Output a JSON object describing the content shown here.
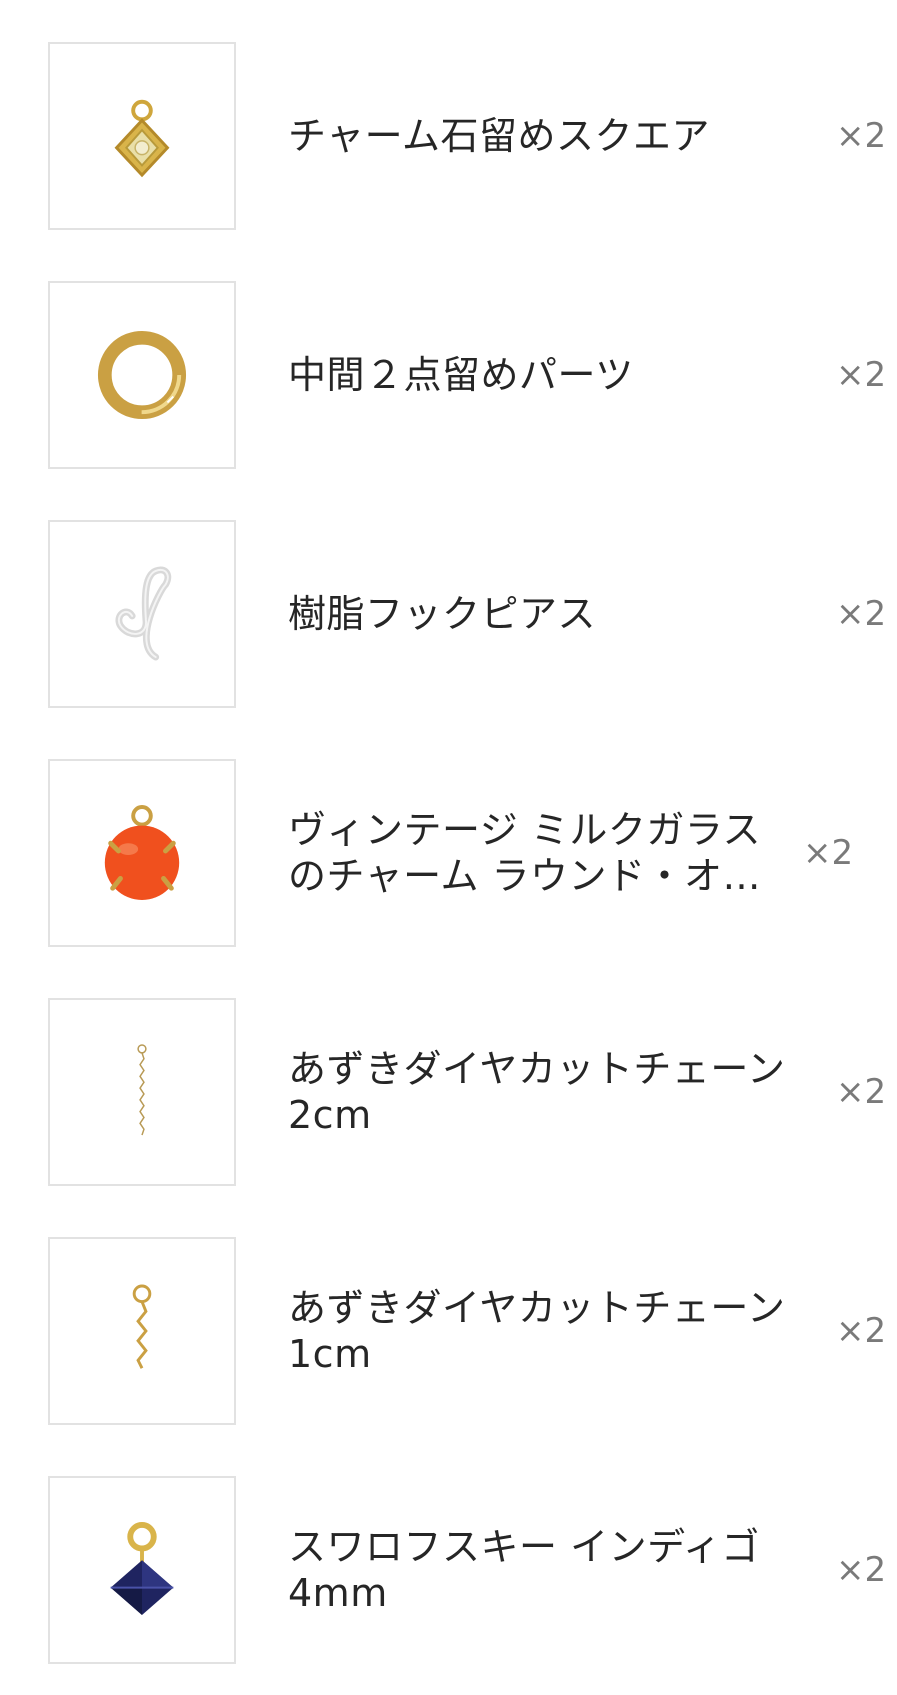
{
  "items": [
    {
      "name": "チャーム石留めスクエア",
      "quantity": "×2",
      "icon": "square-stone-charm-icon"
    },
    {
      "name": "中間２点留めパーツ",
      "quantity": "×2",
      "icon": "gold-jump-ring-icon"
    },
    {
      "name": "樹脂フックピアス",
      "quantity": "×2",
      "icon": "resin-hook-earring-icon"
    },
    {
      "name": "ヴィンテージ ミルクガラス\nのチャーム ラウンド・オ…",
      "quantity": "×2",
      "icon": "orange-round-charm-icon"
    },
    {
      "name": "あずきダイヤカットチェーン\n2cm",
      "quantity": "×2",
      "icon": "chain-2cm-icon"
    },
    {
      "name": "あずきダイヤカットチェーン\n1cm",
      "quantity": "×2",
      "icon": "chain-1cm-icon"
    },
    {
      "name": "スワロフスキー インディゴ\n4mm",
      "quantity": "×2",
      "icon": "indigo-crystal-bead-icon"
    }
  ],
  "colors": {
    "gold": "#d9b44a",
    "orange": "#f0501e",
    "indigo": "#1f2460",
    "border": "#e2e2e2"
  }
}
